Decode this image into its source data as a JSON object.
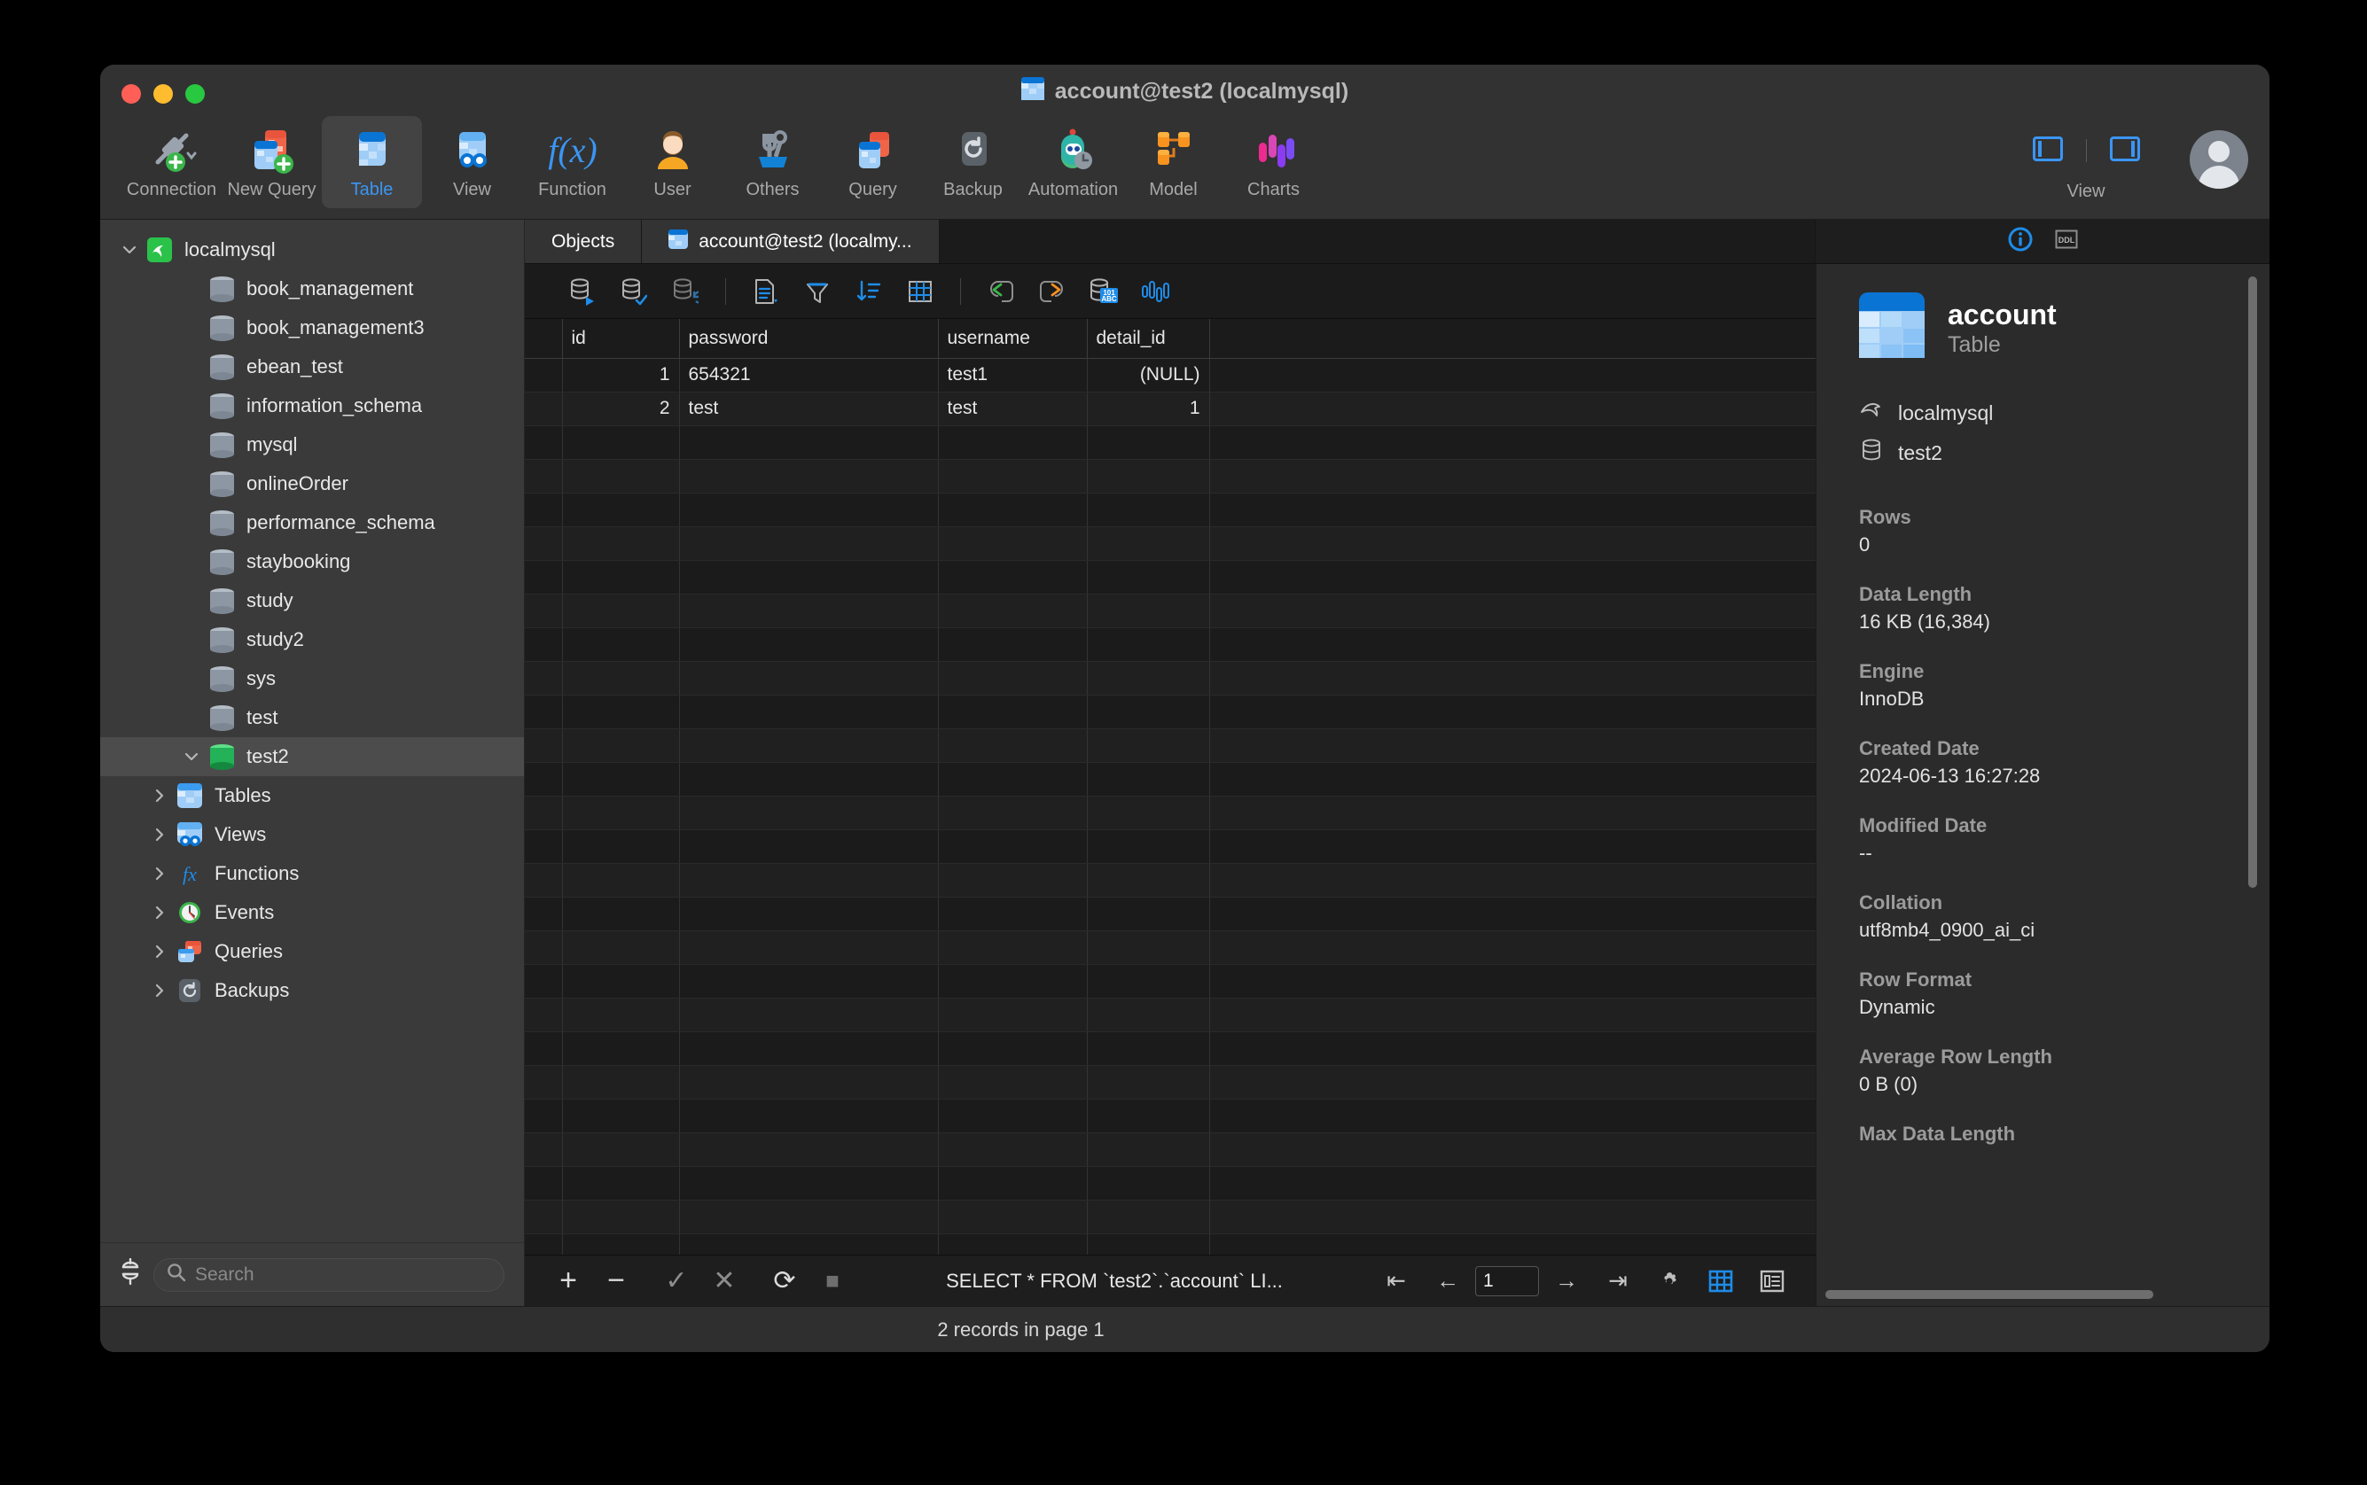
{
  "window": {
    "title": "account@test2 (localmysql)",
    "title_icon": "table-icon"
  },
  "toolbar": {
    "items": [
      {
        "label": "Connection",
        "icon": "connection-plug-icon",
        "active": false
      },
      {
        "label": "New Query",
        "icon": "new-query-icon",
        "active": false
      },
      {
        "label": "Table",
        "icon": "table-icon",
        "active": true
      },
      {
        "label": "View",
        "icon": "view-glasses-icon",
        "active": false
      },
      {
        "label": "Function",
        "icon": "function-fx-icon",
        "active": false
      },
      {
        "label": "User",
        "icon": "user-avatar-icon",
        "active": false
      },
      {
        "label": "Others",
        "icon": "tools-wrench-icon",
        "active": false
      },
      {
        "label": "Query",
        "icon": "query-cards-icon",
        "active": false
      },
      {
        "label": "Backup",
        "icon": "backup-restore-icon",
        "active": false
      },
      {
        "label": "Automation",
        "icon": "automation-robot-icon",
        "active": false
      },
      {
        "label": "Model",
        "icon": "model-nodes-icon",
        "active": false
      },
      {
        "label": "Charts",
        "icon": "charts-bars-icon",
        "active": false
      }
    ],
    "view_label": "View",
    "accent": "#3b95f3"
  },
  "sidebar": {
    "tree": [
      {
        "label": "localmysql",
        "icon": "mysql-dolphin-icon",
        "indent": 0,
        "twisty": "expanded",
        "selected": false
      },
      {
        "label": "book_management",
        "icon": "database-icon",
        "indent": 1,
        "twisty": "none",
        "selected": false
      },
      {
        "label": "book_management3",
        "icon": "database-icon",
        "indent": 1,
        "twisty": "none",
        "selected": false
      },
      {
        "label": "ebean_test",
        "icon": "database-icon",
        "indent": 1,
        "twisty": "none",
        "selected": false
      },
      {
        "label": "information_schema",
        "icon": "database-icon",
        "indent": 1,
        "twisty": "none",
        "selected": false
      },
      {
        "label": "mysql",
        "icon": "database-icon",
        "indent": 1,
        "twisty": "none",
        "selected": false
      },
      {
        "label": "onlineOrder",
        "icon": "database-icon",
        "indent": 1,
        "twisty": "none",
        "selected": false
      },
      {
        "label": "performance_schema",
        "icon": "database-icon",
        "indent": 1,
        "twisty": "none",
        "selected": false
      },
      {
        "label": "staybooking",
        "icon": "database-icon",
        "indent": 1,
        "twisty": "none",
        "selected": false
      },
      {
        "label": "study",
        "icon": "database-icon",
        "indent": 1,
        "twisty": "none",
        "selected": false
      },
      {
        "label": "study2",
        "icon": "database-icon",
        "indent": 1,
        "twisty": "none",
        "selected": false
      },
      {
        "label": "sys",
        "icon": "database-icon",
        "indent": 1,
        "twisty": "none",
        "selected": false
      },
      {
        "label": "test",
        "icon": "database-icon",
        "indent": 1,
        "twisty": "none",
        "selected": false
      },
      {
        "label": "test2",
        "icon": "database-connected-icon",
        "indent": 1,
        "twisty": "expanded",
        "selected": true
      },
      {
        "label": "Tables",
        "icon": "tables-folder-icon",
        "indent": 2,
        "twisty": "collapsed",
        "selected": false
      },
      {
        "label": "Views",
        "icon": "views-folder-icon",
        "indent": 2,
        "twisty": "collapsed",
        "selected": false
      },
      {
        "label": "Functions",
        "icon": "functions-folder-icon",
        "indent": 2,
        "twisty": "collapsed",
        "selected": false
      },
      {
        "label": "Events",
        "icon": "events-clock-icon",
        "indent": 2,
        "twisty": "collapsed",
        "selected": false
      },
      {
        "label": "Queries",
        "icon": "queries-folder-icon",
        "indent": 2,
        "twisty": "collapsed",
        "selected": false
      },
      {
        "label": "Backups",
        "icon": "backups-folder-icon",
        "indent": 2,
        "twisty": "collapsed",
        "selected": false
      }
    ],
    "search_placeholder": "Search",
    "connection_icon": "connection-status-icon"
  },
  "tabs": [
    {
      "label": "Objects",
      "icon": null,
      "active": false
    },
    {
      "label": "account@test2 (localmy...",
      "icon": "table-icon",
      "active": true
    }
  ],
  "grid_toolbar": {
    "buttons": [
      {
        "name": "run-sql-icon"
      },
      {
        "name": "apply-changes-icon"
      },
      {
        "name": "revert-changes-icon"
      },
      {
        "name": "text-view-icon"
      },
      {
        "name": "filter-icon"
      },
      {
        "name": "sort-icon"
      },
      {
        "name": "grid-columns-icon"
      },
      {
        "name": "undo-icon"
      },
      {
        "name": "redo-icon"
      },
      {
        "name": "data-generation-icon"
      },
      {
        "name": "data-analysis-icon"
      }
    ]
  },
  "table": {
    "columns": [
      "id",
      "password",
      "username",
      "detail_id"
    ],
    "rows": [
      {
        "id": "1",
        "password": "654321",
        "username": "test1",
        "detail_id": "(NULL)",
        "detail_is_null": true
      },
      {
        "id": "2",
        "password": "test",
        "username": "test",
        "detail_id": "1",
        "detail_is_null": false
      }
    ],
    "empty_row_count": 30
  },
  "bottom_bar": {
    "add_label": "+",
    "remove_label": "−",
    "confirm_label": "✓",
    "cancel_label": "✕",
    "refresh_label": "⟳",
    "stop_label": "■",
    "sql": "SELECT * FROM `test2`.`account` LI...",
    "page_value": "1",
    "first_label": "⇤",
    "prev_label": "←",
    "next_label": "→",
    "last_label": "⇥",
    "settings_icon": "gear-icon",
    "grid_view_icon": "grid-view-icon",
    "form_view_icon": "form-view-icon"
  },
  "info_panel": {
    "tabs": [
      {
        "icon": "info-circle-icon",
        "label": "",
        "active": true
      },
      {
        "icon": "ddl-icon",
        "label": "DDL",
        "active": false
      }
    ],
    "object_name": "account",
    "object_type": "Table",
    "object_icon": "table-icon",
    "connection": "localmysql",
    "database": "test2",
    "properties": [
      {
        "key": "Rows",
        "value": "0"
      },
      {
        "key": "Data Length",
        "value": "16 KB (16,384)"
      },
      {
        "key": "Engine",
        "value": "InnoDB"
      },
      {
        "key": "Created Date",
        "value": "2024-06-13 16:27:28"
      },
      {
        "key": "Modified Date",
        "value": "--"
      },
      {
        "key": "Collation",
        "value": "utf8mb4_0900_ai_ci"
      },
      {
        "key": "Row Format",
        "value": "Dynamic"
      },
      {
        "key": "Average Row Length",
        "value": "0 B (0)"
      },
      {
        "key": "Max Data Length",
        "value": ""
      }
    ]
  },
  "status_bar": {
    "text": "2 records in page 1"
  }
}
